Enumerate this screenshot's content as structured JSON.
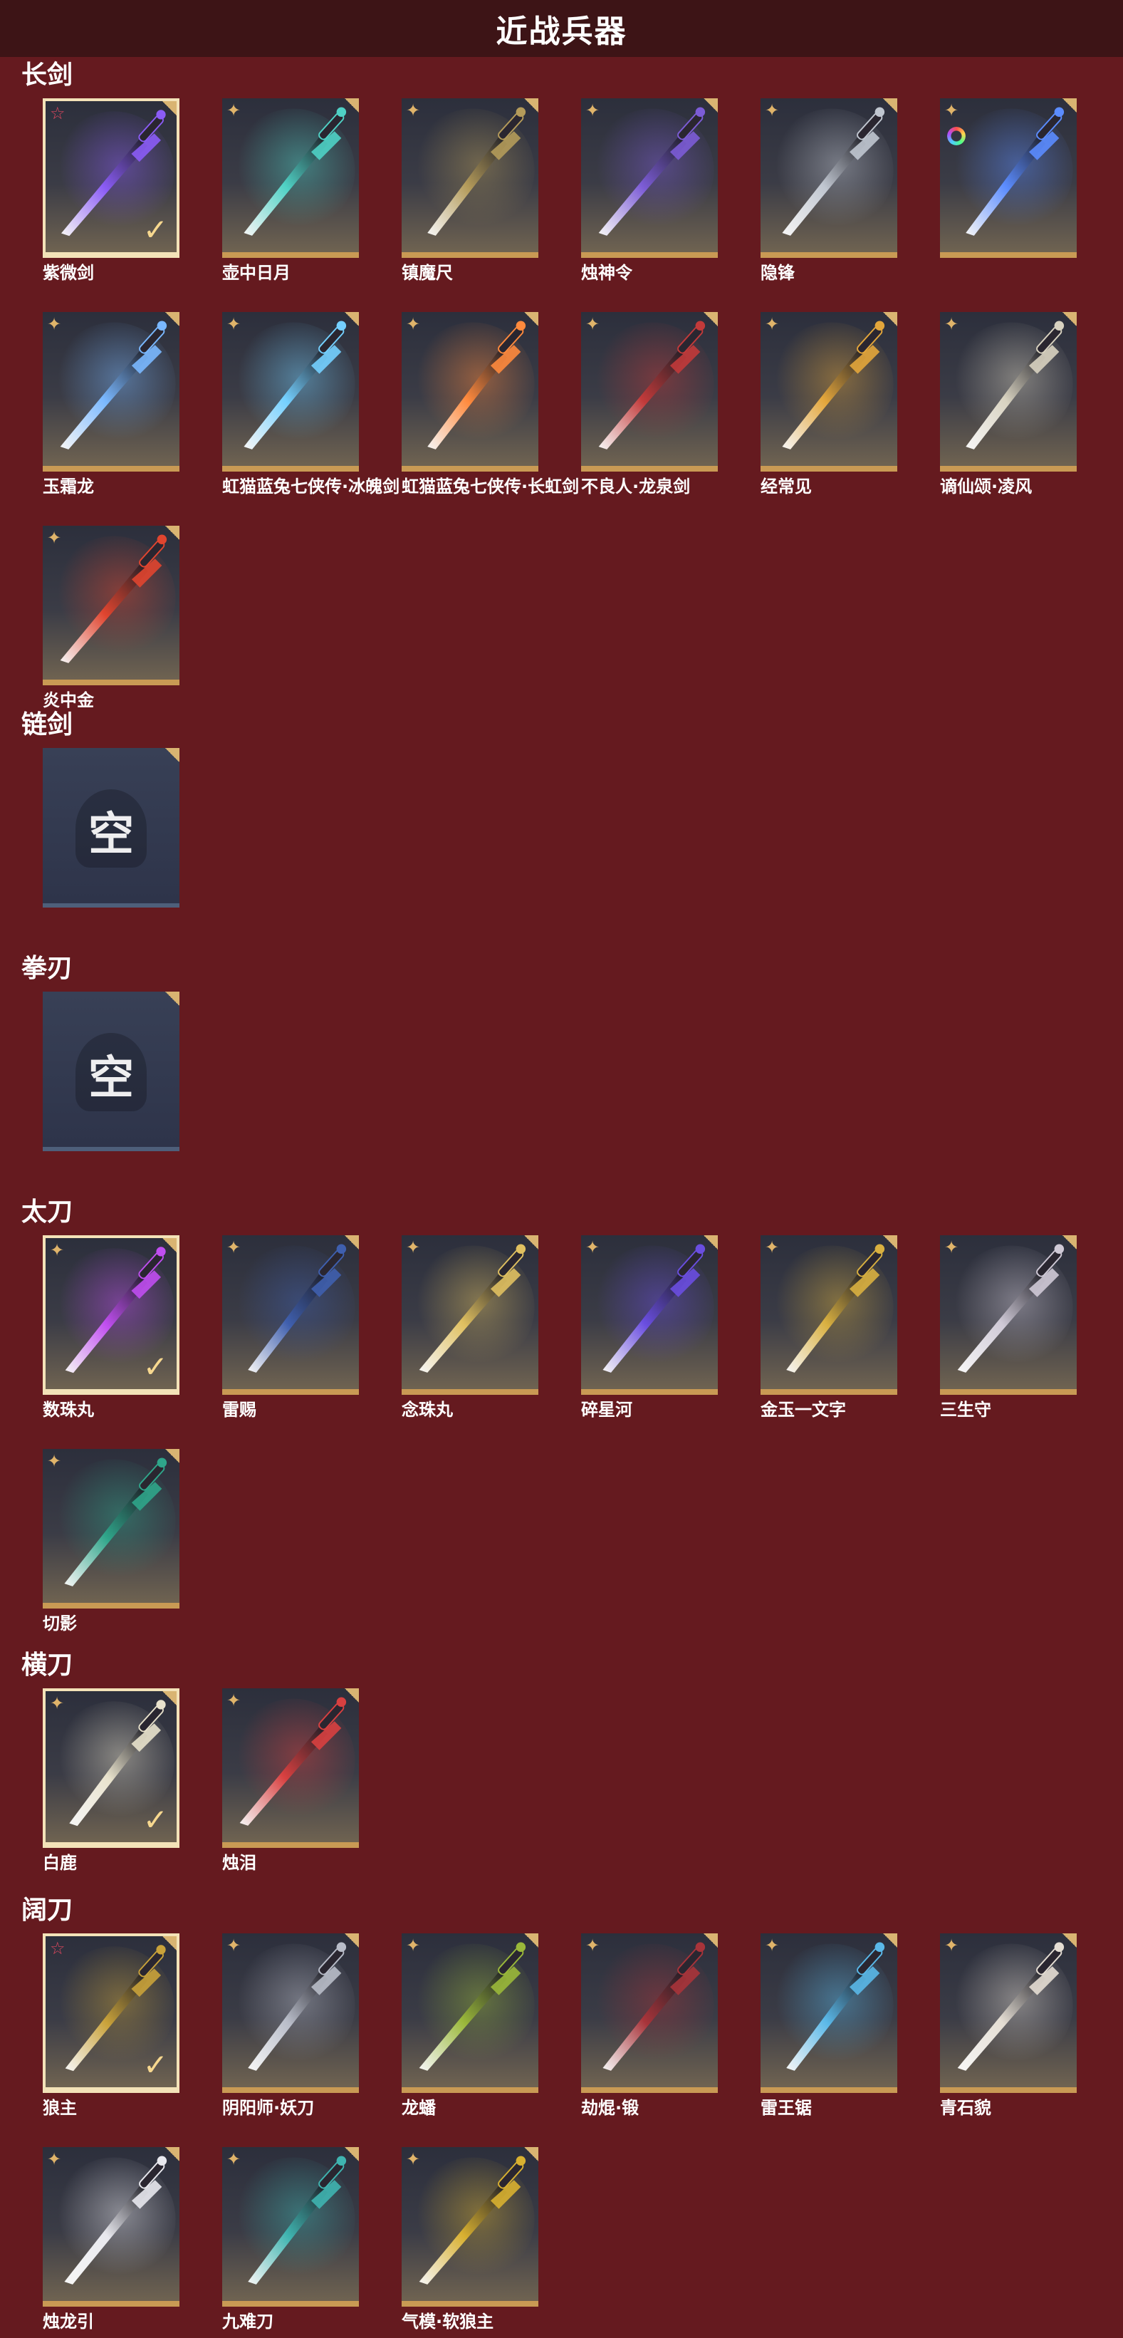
{
  "page_title": "近战兵器",
  "icons": {
    "star_badge": "star-badge-icon",
    "selected": "checkmark-icon",
    "empty": "empty-slot-icon"
  },
  "colors": {
    "background": "#651a1f",
    "header": "#3d1416",
    "card_border": "#c99a54",
    "selected_border": "#f3e2b8",
    "accent_red": "#e0485e"
  },
  "sections": [
    {
      "title": "长剑",
      "items": [
        {
          "label": "紫微剑",
          "selected": true,
          "badge": "red",
          "hue": "#8b5cf6"
        },
        {
          "label": "壶中日月",
          "selected": false,
          "badge": "gold",
          "hue": "#4fd1c5"
        },
        {
          "label": "镇魔尺",
          "selected": false,
          "badge": "gold",
          "hue": "#b49b5a"
        },
        {
          "label": "烛神令",
          "selected": false,
          "badge": "gold",
          "hue": "#7c5cd6"
        },
        {
          "label": "隐锋",
          "selected": false,
          "badge": "gold",
          "hue": "#c0c6d0"
        },
        {
          "label": "",
          "selected": false,
          "badge": "gold",
          "hue": "#5b8cff",
          "ring": true
        },
        {
          "label": "玉霜龙",
          "selected": false,
          "badge": "gold",
          "hue": "#7ab8ff"
        },
        {
          "label": "虹猫蓝兔七侠传·冰魄剑",
          "selected": false,
          "badge": "gold",
          "hue": "#74d0ff"
        },
        {
          "label": "虹猫蓝兔七侠传·长虹剑",
          "selected": false,
          "badge": "gold",
          "hue": "#ff8a3d"
        },
        {
          "label": "不良人·龙泉剑",
          "selected": false,
          "badge": "gold",
          "hue": "#c23a3a"
        },
        {
          "label": "经常见",
          "selected": false,
          "badge": "gold",
          "hue": "#e3a63b"
        },
        {
          "label": "谪仙颂·凌风",
          "selected": false,
          "badge": "gold",
          "hue": "#d8d2c0"
        },
        {
          "label": "炎中金",
          "selected": false,
          "badge": "gold",
          "hue": "#e0452f"
        }
      ]
    },
    {
      "title": "链剑",
      "empty": true,
      "empty_glyph": "空"
    },
    {
      "title": "拳刃",
      "empty": true,
      "empty_glyph": "空"
    },
    {
      "title": "太刀",
      "items": [
        {
          "label": "数珠丸",
          "selected": true,
          "badge": "gold",
          "hue": "#c04ef0"
        },
        {
          "label": "雷赐",
          "selected": false,
          "badge": "gold",
          "hue": "#3f5fae"
        },
        {
          "label": "念珠丸",
          "selected": false,
          "badge": "gold",
          "hue": "#e0c060"
        },
        {
          "label": "碎星河",
          "selected": false,
          "badge": "gold",
          "hue": "#6a4ee0"
        },
        {
          "label": "金玉一文字",
          "selected": false,
          "badge": "gold",
          "hue": "#d9b040"
        },
        {
          "label": "三生守",
          "selected": false,
          "badge": "gold",
          "hue": "#cfc9d6"
        },
        {
          "label": "切影",
          "selected": false,
          "badge": "gold",
          "hue": "#2fa58a"
        }
      ]
    },
    {
      "title": "横刀",
      "items": [
        {
          "label": "白鹿",
          "selected": true,
          "badge": "gold",
          "hue": "#e8e2cc"
        },
        {
          "label": "烛泪",
          "selected": false,
          "badge": "gold",
          "hue": "#d84040"
        }
      ]
    },
    {
      "title": "阔刀",
      "items": [
        {
          "label": "狼主",
          "selected": true,
          "badge": "red",
          "hue": "#c9a23a"
        },
        {
          "label": "阴阳师·妖刀",
          "selected": false,
          "badge": "gold",
          "hue": "#b8bcc8"
        },
        {
          "label": "龙蟠",
          "selected": false,
          "badge": "gold",
          "hue": "#9ab83a"
        },
        {
          "label": "劫焜·锻",
          "selected": false,
          "badge": "gold",
          "hue": "#a8343a"
        },
        {
          "label": "雷王锯",
          "selected": false,
          "badge": "gold",
          "hue": "#5ab8e8"
        },
        {
          "label": "青石貌",
          "selected": false,
          "badge": "gold",
          "hue": "#e4ddd3"
        },
        {
          "label": "烛龙引",
          "selected": false,
          "badge": "gold",
          "hue": "#e8e8ee"
        },
        {
          "label": "九难刀",
          "selected": false,
          "badge": "gold",
          "hue": "#3fb4b0"
        },
        {
          "label": "气模·软狼主",
          "selected": false,
          "badge": "gold",
          "hue": "#d8b030"
        }
      ]
    }
  ]
}
